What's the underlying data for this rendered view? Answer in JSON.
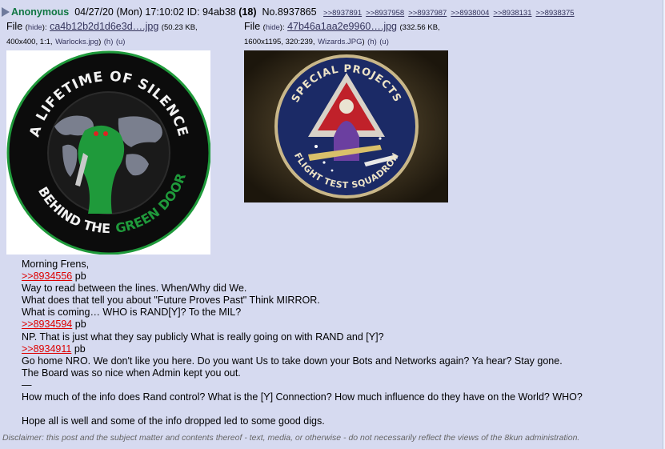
{
  "post": {
    "author": "Anonymous",
    "date": "04/27/20 (Mon) 17:10:02",
    "id_label": "ID:",
    "id_value": "94ab38",
    "id_count": "(18)",
    "number": "No.8937865",
    "replies": [
      ">>8937891",
      ">>8937958",
      ">>8937987",
      ">>8938004",
      ">>8938131",
      ">>8938375"
    ]
  },
  "files": [
    {
      "file_label": "File",
      "hide": "hide",
      "name": "ca4b12b2d1d6e3d….jpg",
      "size": "(50.23 KB,",
      "dims": "400x400, 1:1,",
      "orig_name": "Warlocks.jpg",
      "h": "(h)",
      "u": "(u)",
      "patch_top": "A LIFETIME OF SILENCE",
      "patch_bottom1": "BEHIND THE",
      "patch_bottom2": "GREEN DOOR"
    },
    {
      "file_label": "File",
      "hide": "hide",
      "name": "47b46a1aa2e9960….jpg",
      "size": "(332.56 KB,",
      "dims": "1600x1195, 320:239,",
      "orig_name": "Wizards.JPG",
      "h": "(h)",
      "u": "(u)",
      "patch_top": "SPECIAL PROJECTS",
      "patch_bottom": "FLIGHT TEST SQUADRON"
    }
  ],
  "body_lines": [
    {
      "type": "text",
      "text": "Morning Frens,"
    },
    {
      "type": "quote",
      "link": ">>8934556",
      "suffix": " pb"
    },
    {
      "type": "text",
      "text": "Way to read between the lines. When/Why did We."
    },
    {
      "type": "text",
      "text": "What does that tell you about \"Future Proves Past\" Think MIRROR."
    },
    {
      "type": "text",
      "text": "What is coming… WHO is RAND[Y]? To the MIL?"
    },
    {
      "type": "quote",
      "link": ">>8934594",
      "suffix": " pb"
    },
    {
      "type": "text",
      "text": "NP. That is just what they say publicly What is really going on with RAND and [Y]?"
    },
    {
      "type": "quote",
      "link": ">>8934911",
      "suffix": " pb"
    },
    {
      "type": "text",
      "text": "Go home NRO. We don't like you here. Do you want Us to take down your Bots and Networks again? Ya hear? Stay gone."
    },
    {
      "type": "text",
      "text": "The Board was so nice when Admin kept you out."
    },
    {
      "type": "text",
      "text": "—"
    },
    {
      "type": "text",
      "text": "How much of the info does Rand control? What is the [Y] Connection? How much influence do they have on the World? WHO?"
    },
    {
      "type": "text",
      "text": ""
    },
    {
      "type": "text",
      "text": "Hope all is well and some of the info dropped led to some good digs."
    }
  ],
  "disclaimer": "Disclaimer: this post and the subject matter and contents thereof - text, media, or otherwise - do not necessarily reflect the views of the 8kun administration.",
  "colors": {
    "name": "#117743",
    "quotelink": "#dd0000",
    "post_bg": "#d6daf0",
    "link": "#34345c"
  }
}
